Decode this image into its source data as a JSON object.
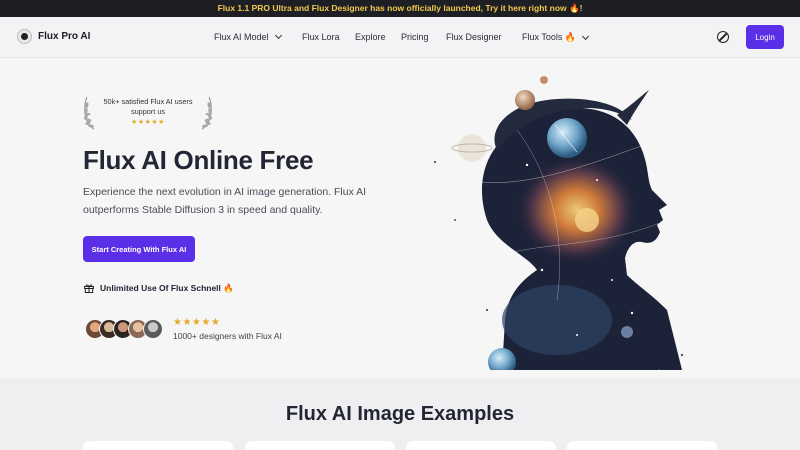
{
  "announcement": "Flux 1.1 PRO Ultra and Flux Designer has now officially launched, Try it here right now 🔥!",
  "brand": {
    "name": "Flux Pro AI",
    "icon": "flux-logo-icon"
  },
  "nav": {
    "items": [
      {
        "label": "Flux AI Model",
        "dropdown": true
      },
      {
        "label": "Flux Lora",
        "dropdown": false
      },
      {
        "label": "Explore",
        "dropdown": false
      },
      {
        "label": "Pricing",
        "dropdown": false
      },
      {
        "label": "Flux Designer",
        "dropdown": false
      },
      {
        "label": "Flux Tools 🔥",
        "dropdown": true
      }
    ],
    "theme_icon": "theme-toggle-icon",
    "login_label": "Login"
  },
  "hero": {
    "badge_text": "50k+ satisfied Flux AI users support us",
    "badge_stars": "★★★★★",
    "title": "Flux AI Online Free",
    "subtitle": "Experience the next evolution in AI image generation. Flux AI outperforms Stable Diffusion 3 in speed and quality.",
    "cta_label": "Start Creating With Flux AI",
    "feature_label": "Unlimited Use Of Flux Schnell 🔥",
    "feature_icon": "gift-icon",
    "proof_stars": "★★★★★",
    "proof_text": "1000+ designers with Flux AI",
    "avatar_count": 5
  },
  "examples": {
    "title": "Flux AI Image Examples"
  },
  "colors": {
    "accent": "#5b2ee8",
    "star": "#e2ab2c",
    "announce_bg": "#1d1f25",
    "announce_text": "#f2c94c"
  }
}
